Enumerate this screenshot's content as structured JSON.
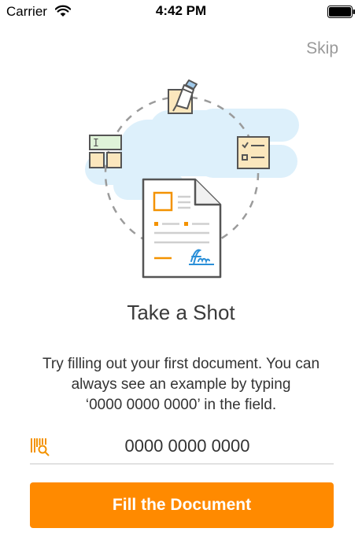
{
  "status_bar": {
    "carrier": "Carrier",
    "time": "4:42 PM"
  },
  "skip_label": "Skip",
  "title": "Take a Shot",
  "description": {
    "line1": "Try filling out your first document. You can",
    "line2": "always see an example by typing",
    "line3": "‘0000 0000 0000’ in the field."
  },
  "field": {
    "value": "0000 0000 0000",
    "placeholder": "0000 0000 0000"
  },
  "fill_button_label": "Fill the Document",
  "icons": {
    "wifi": "wifi-icon",
    "battery": "battery-icon",
    "barcode": "barcode-scan-icon",
    "pen": "pen-nib-icon",
    "checklist": "checklist-icon",
    "form": "form-layout-icon",
    "document": "signed-document-icon"
  },
  "colors": {
    "accent": "#ff8a00",
    "illustration_orange": "#f39200",
    "illustration_blue": "#2a8fd8",
    "cloud": "#ddf0fb",
    "card_fill": "#fbe7bd",
    "outline": "#555555"
  }
}
